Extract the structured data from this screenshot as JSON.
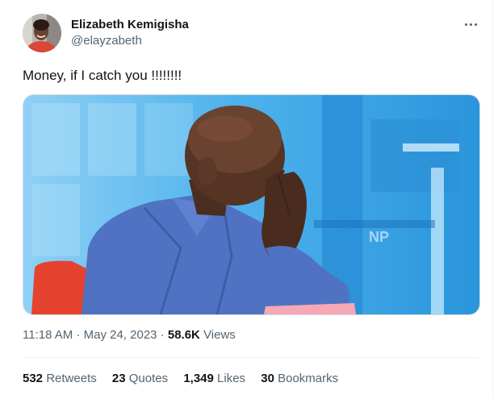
{
  "author": {
    "name": "Elizabeth Kemigisha",
    "handle": "@elayzabeth"
  },
  "tweet": {
    "text": "Money,  if I catch you !!!!!!!!",
    "time": "11:18 AM",
    "date": "May 24, 2023",
    "views_count": "58.6K",
    "views_label": "Views",
    "separator": "·"
  },
  "photo": {
    "watermark": "NP"
  },
  "stats": [
    {
      "count": "532",
      "label": "Retweets"
    },
    {
      "count": "23",
      "label": "Quotes"
    },
    {
      "count": "1,349",
      "label": "Likes"
    },
    {
      "count": "30",
      "label": "Bookmarks"
    }
  ],
  "colors": {
    "text": "#0f1419",
    "secondary": "#536471",
    "divider": "#eff3f4",
    "photo_bg": "#35a5e6",
    "shirt": "#4f73c2",
    "chair": "#e5432f"
  },
  "icons": {
    "more": "more-horizontal-icon"
  }
}
